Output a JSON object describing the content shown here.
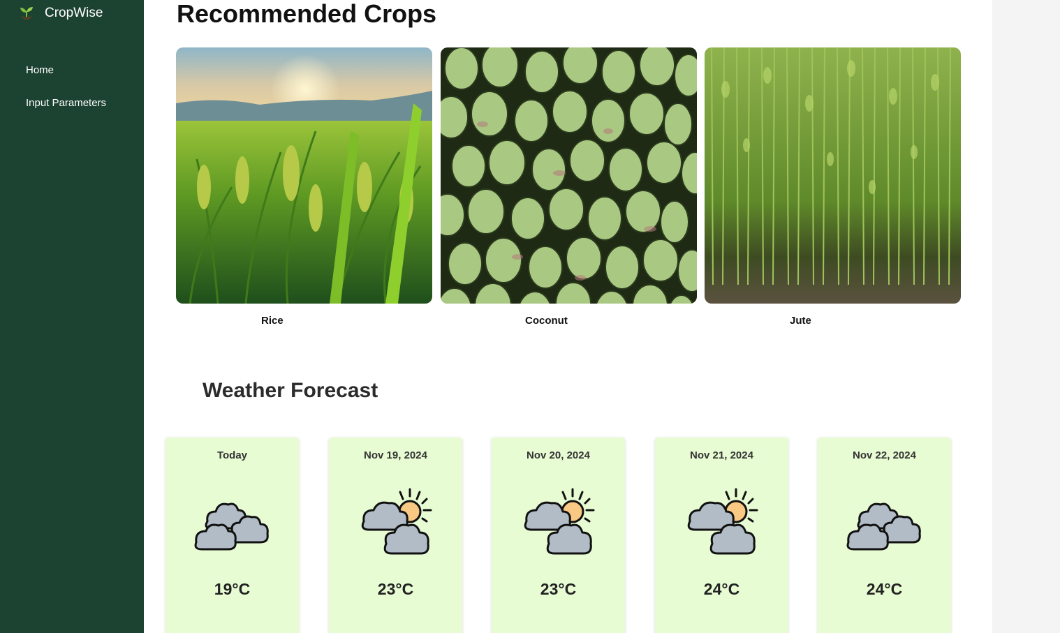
{
  "app": {
    "name": "CropWise"
  },
  "nav": {
    "items": [
      {
        "label": "Home"
      },
      {
        "label": "Input Parameters"
      }
    ]
  },
  "crops": {
    "title": "Recommended Crops",
    "items": [
      {
        "name": "Rice"
      },
      {
        "name": "Coconut"
      },
      {
        "name": "Jute"
      }
    ]
  },
  "weather": {
    "title": "Weather Forecast",
    "days": [
      {
        "date": "Today",
        "temp": "19°C",
        "icon": "cloudy-icon"
      },
      {
        "date": "Nov 19, 2024",
        "temp": "23°C",
        "icon": "partly-cloudy-icon"
      },
      {
        "date": "Nov 20, 2024",
        "temp": "23°C",
        "icon": "partly-cloudy-icon"
      },
      {
        "date": "Nov 21, 2024",
        "temp": "24°C",
        "icon": "partly-cloudy-icon"
      },
      {
        "date": "Nov 22, 2024",
        "temp": "24°C",
        "icon": "cloudy-icon"
      }
    ]
  },
  "colors": {
    "sidebar": "#1c4231",
    "card_bg": "#e8fcd4",
    "cloud": "#b1bcc6",
    "sun": "#f9c883"
  }
}
